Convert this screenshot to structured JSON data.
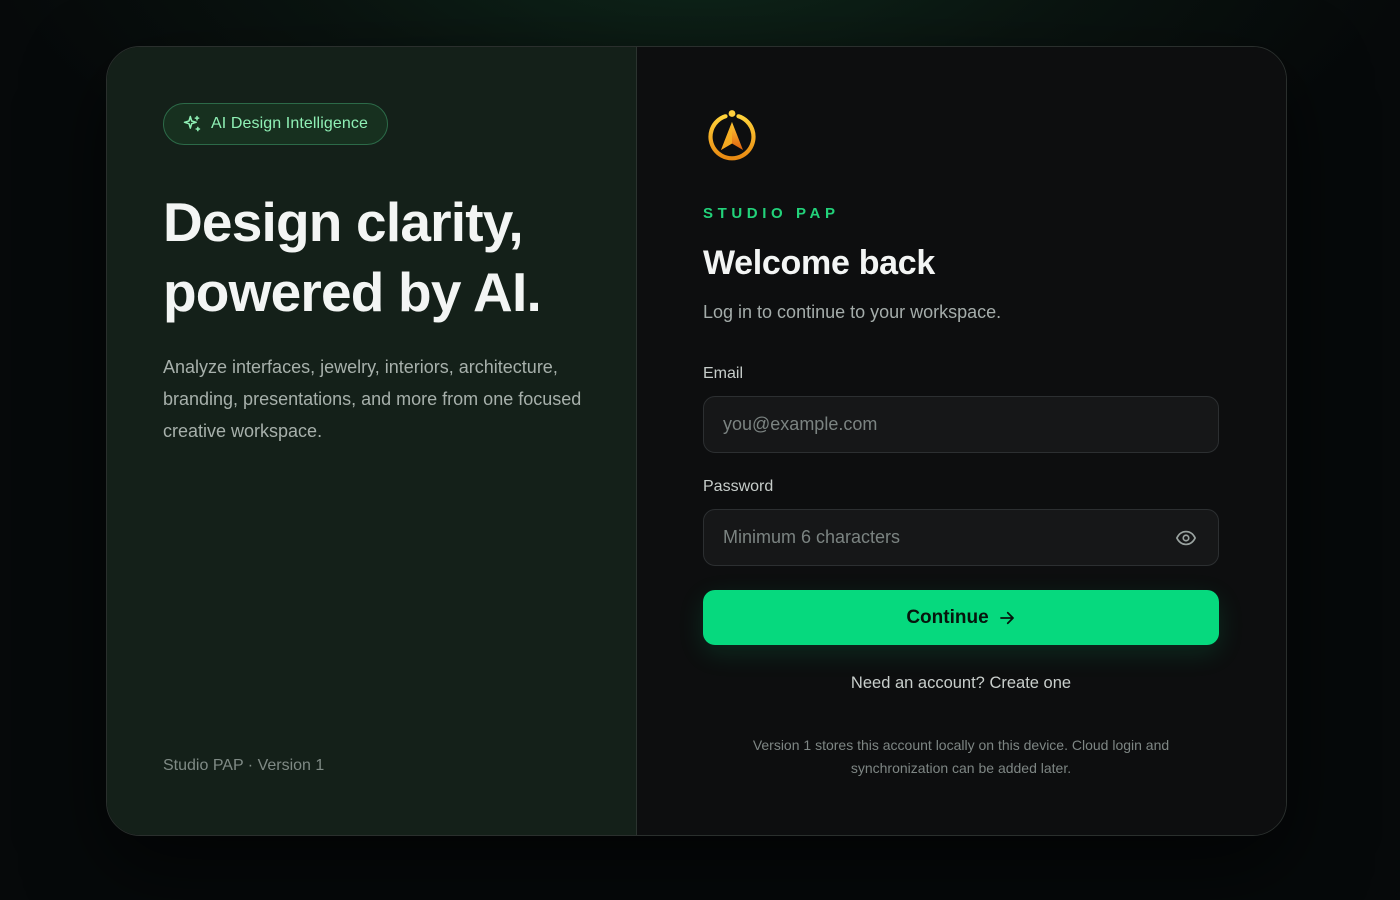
{
  "colors": {
    "accent": "#06d97e",
    "brand_text": "#22d27a",
    "left_panel_bg": "#142019",
    "right_panel_bg": "#0d0e0f",
    "logo_gold": "#f5b31a"
  },
  "hero": {
    "badge": {
      "icon": "sparkle-icon",
      "label": "AI Design Intelligence"
    },
    "headline_line1": "Design clarity,",
    "headline_line2": "powered by AI.",
    "description": "Analyze interfaces, jewelry, interiors, architecture, branding, presentations, and more from one focused creative workspace.",
    "footer": "Studio PAP · Version 1"
  },
  "login": {
    "logo_icon": "compass-logo-icon",
    "brand": "STUDIO PAP",
    "title": "Welcome back",
    "subtitle": "Log in to continue to your workspace.",
    "email": {
      "label": "Email",
      "value": "",
      "placeholder": "you@example.com"
    },
    "password": {
      "label": "Password",
      "value": "",
      "placeholder": "Minimum 6 characters",
      "toggle_icon": "eye-icon"
    },
    "continue_label": "Continue",
    "continue_icon": "arrow-right-icon",
    "account_link": "Need an account? Create one",
    "version_note": "Version 1 stores this account locally on this device. Cloud login and synchronization can be added later."
  }
}
